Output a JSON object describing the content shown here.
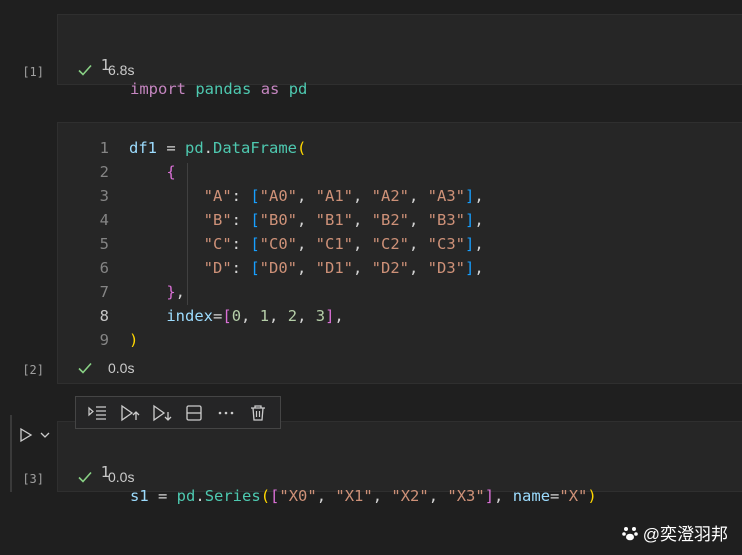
{
  "cells": [
    {
      "exec_count": "[1]",
      "status_time": "6.8s",
      "lines": [
        {
          "num": "1",
          "tokens": [
            [
              "k",
              "import"
            ],
            [
              "p",
              " "
            ],
            [
              "t",
              "pandas"
            ],
            [
              "p",
              " "
            ],
            [
              "k",
              "as"
            ],
            [
              "p",
              " "
            ],
            [
              "t",
              "pd"
            ]
          ]
        }
      ]
    },
    {
      "exec_count": "[2]",
      "status_time": "0.0s",
      "lines": [
        {
          "num": "1",
          "tokens": [
            [
              "v",
              "df1"
            ],
            [
              "p",
              " = "
            ],
            [
              "t",
              "pd"
            ],
            [
              "p",
              "."
            ],
            [
              "t",
              "DataFrame"
            ],
            [
              "b1",
              "("
            ]
          ]
        },
        {
          "num": "2",
          "tokens": [
            [
              "p",
              "    "
            ],
            [
              "b2",
              "{"
            ]
          ]
        },
        {
          "num": "3",
          "tokens": [
            [
              "p",
              "        "
            ],
            [
              "s",
              "\"A\""
            ],
            [
              "p",
              ": "
            ],
            [
              "b3",
              "["
            ],
            [
              "s",
              "\"A0\""
            ],
            [
              "p",
              ", "
            ],
            [
              "s",
              "\"A1\""
            ],
            [
              "p",
              ", "
            ],
            [
              "s",
              "\"A2\""
            ],
            [
              "p",
              ", "
            ],
            [
              "s",
              "\"A3\""
            ],
            [
              "b3",
              "]"
            ],
            [
              "p",
              ","
            ]
          ]
        },
        {
          "num": "4",
          "tokens": [
            [
              "p",
              "        "
            ],
            [
              "s",
              "\"B\""
            ],
            [
              "p",
              ": "
            ],
            [
              "b3",
              "["
            ],
            [
              "s",
              "\"B0\""
            ],
            [
              "p",
              ", "
            ],
            [
              "s",
              "\"B1\""
            ],
            [
              "p",
              ", "
            ],
            [
              "s",
              "\"B2\""
            ],
            [
              "p",
              ", "
            ],
            [
              "s",
              "\"B3\""
            ],
            [
              "b3",
              "]"
            ],
            [
              "p",
              ","
            ]
          ]
        },
        {
          "num": "5",
          "tokens": [
            [
              "p",
              "        "
            ],
            [
              "s",
              "\"C\""
            ],
            [
              "p",
              ": "
            ],
            [
              "b3",
              "["
            ],
            [
              "s",
              "\"C0\""
            ],
            [
              "p",
              ", "
            ],
            [
              "s",
              "\"C1\""
            ],
            [
              "p",
              ", "
            ],
            [
              "s",
              "\"C2\""
            ],
            [
              "p",
              ", "
            ],
            [
              "s",
              "\"C3\""
            ],
            [
              "b3",
              "]"
            ],
            [
              "p",
              ","
            ]
          ]
        },
        {
          "num": "6",
          "tokens": [
            [
              "p",
              "        "
            ],
            [
              "s",
              "\"D\""
            ],
            [
              "p",
              ": "
            ],
            [
              "b3",
              "["
            ],
            [
              "s",
              "\"D0\""
            ],
            [
              "p",
              ", "
            ],
            [
              "s",
              "\"D1\""
            ],
            [
              "p",
              ", "
            ],
            [
              "s",
              "\"D2\""
            ],
            [
              "p",
              ", "
            ],
            [
              "s",
              "\"D3\""
            ],
            [
              "b3",
              "]"
            ],
            [
              "p",
              ","
            ]
          ]
        },
        {
          "num": "7",
          "tokens": [
            [
              "p",
              "    "
            ],
            [
              "b2",
              "}"
            ],
            [
              "p",
              ","
            ]
          ]
        },
        {
          "num": "8",
          "active": true,
          "tokens": [
            [
              "p",
              "    "
            ],
            [
              "v",
              "index"
            ],
            [
              "p",
              "="
            ],
            [
              "b2",
              "["
            ],
            [
              "n",
              "0"
            ],
            [
              "p",
              ", "
            ],
            [
              "n",
              "1"
            ],
            [
              "p",
              ", "
            ],
            [
              "n",
              "2"
            ],
            [
              "p",
              ", "
            ],
            [
              "n",
              "3"
            ],
            [
              "b2",
              "]"
            ],
            [
              "p",
              ","
            ]
          ]
        },
        {
          "num": "9",
          "tokens": [
            [
              "b1",
              ")"
            ]
          ]
        }
      ]
    },
    {
      "exec_count": "[3]",
      "status_time": "0.0s",
      "lines": [
        {
          "num": "1",
          "tokens": [
            [
              "v",
              "s1"
            ],
            [
              "p",
              " = "
            ],
            [
              "t",
              "pd"
            ],
            [
              "p",
              "."
            ],
            [
              "t",
              "Series"
            ],
            [
              "b1",
              "("
            ],
            [
              "b2",
              "["
            ],
            [
              "s",
              "\"X0\""
            ],
            [
              "p",
              ", "
            ],
            [
              "s",
              "\"X1\""
            ],
            [
              "p",
              ", "
            ],
            [
              "s",
              "\"X2\""
            ],
            [
              "p",
              ", "
            ],
            [
              "s",
              "\"X3\""
            ],
            [
              "b2",
              "]"
            ],
            [
              "p",
              ", "
            ],
            [
              "v",
              "name"
            ],
            [
              "p",
              "="
            ],
            [
              "s",
              "\"X\""
            ],
            [
              "b1",
              ")"
            ]
          ]
        }
      ]
    }
  ],
  "toolbar_icons": [
    "run-by-line-icon",
    "execute-above-icon",
    "execute-below-icon",
    "split-cell-icon",
    "more-actions-icon",
    "delete-cell-icon"
  ],
  "run_icon": "play-icon",
  "watermark": "@奕澄羽邦"
}
